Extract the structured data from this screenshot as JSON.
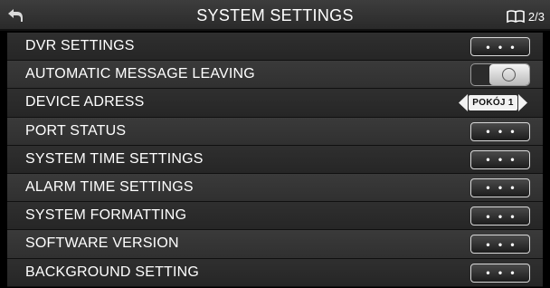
{
  "header": {
    "title": "SYSTEM SETTINGS",
    "page_indicator": "2/3",
    "back_icon": "back-arrow-icon",
    "pages_icon": "book-icon"
  },
  "settings": [
    {
      "label": "DVR SETTINGS",
      "control": "more",
      "value": "• • •"
    },
    {
      "label": "AUTOMATIC MESSAGE LEAVING",
      "control": "toggle",
      "state": "on"
    },
    {
      "label": "DEVICE ADRESS",
      "control": "selector",
      "value": "POKÓJ 1"
    },
    {
      "label": "PORT STATUS",
      "control": "more",
      "value": "• • •"
    },
    {
      "label": "SYSTEM TIME SETTINGS",
      "control": "more",
      "value": "• • •"
    },
    {
      "label": "ALARM TIME SETTINGS",
      "control": "more",
      "value": "• • •"
    },
    {
      "label": "SYSTEM FORMATTING",
      "control": "more",
      "value": "• • •"
    },
    {
      "label": "SOFTWARE VERSION",
      "control": "more",
      "value": "• • •"
    },
    {
      "label": "BACKGROUND SETTING",
      "control": "more",
      "value": "• • •"
    }
  ]
}
